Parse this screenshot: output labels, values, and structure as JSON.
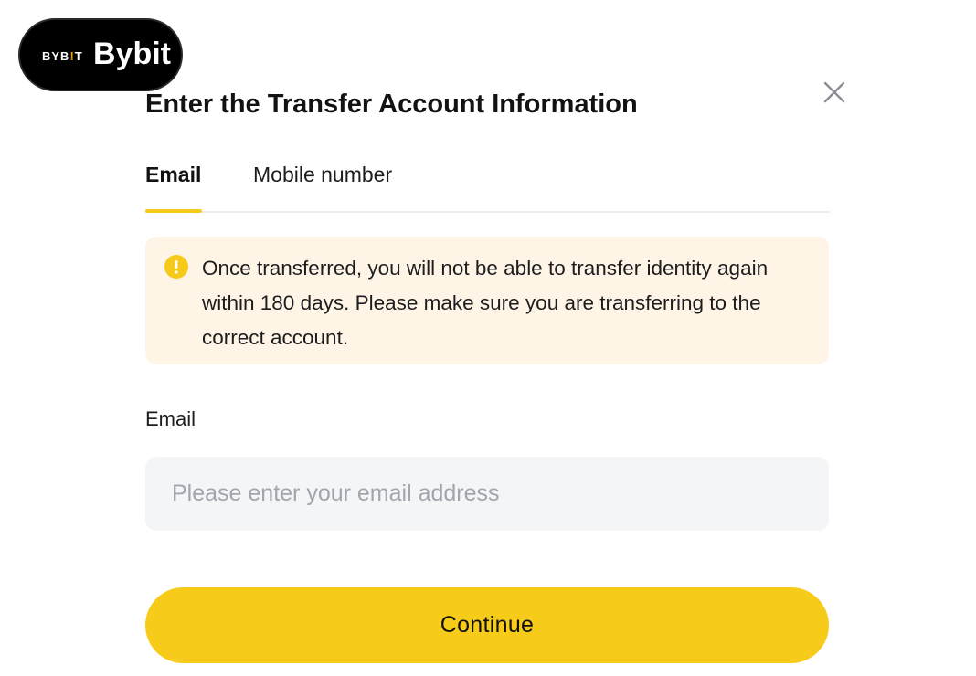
{
  "brand": {
    "mark_prefix": "BYB",
    "mark_accent": "!",
    "mark_suffix": "T",
    "name": "Bybit"
  },
  "dialog": {
    "title": "Enter the Transfer Account Information",
    "close_icon": "close-icon"
  },
  "tabs": [
    {
      "label": "Email",
      "active": true
    },
    {
      "label": "Mobile number",
      "active": false
    }
  ],
  "notice": {
    "icon": "warning-icon",
    "text": "Once transferred, you will not be able to transfer identity again within 180 days. Please make sure you are transferring to the correct account."
  },
  "email_field": {
    "label": "Email",
    "value": "",
    "placeholder": "Please enter your email address"
  },
  "continue_button": {
    "label": "Continue"
  },
  "colors": {
    "accent": "#f7cb1a",
    "notice_bg": "#fff5e6",
    "notice_icon": "#f7c91a",
    "input_bg": "#f4f5f7",
    "brand_badge_bg": "#000000",
    "brand_accent": "#f7a600"
  }
}
